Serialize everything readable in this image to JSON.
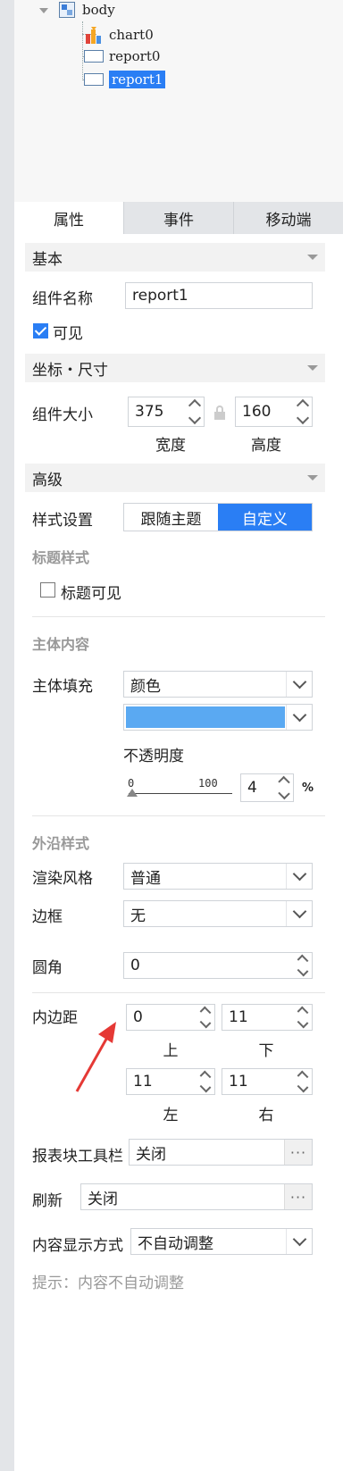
{
  "tree": {
    "root": "body",
    "children": [
      "chart0",
      "report0",
      "report1"
    ],
    "selected": "report1"
  },
  "tabs": [
    "属性",
    "事件",
    "移动端"
  ],
  "active_tab": "属性",
  "basic": {
    "header": "基本",
    "component_name_label": "组件名称",
    "component_name_value": "report1",
    "visible_label": "可见",
    "visible_checked": true
  },
  "coords": {
    "header": "坐标・尺寸",
    "size_label": "组件大小",
    "width_value": "375",
    "height_value": "160",
    "width_caption": "宽度",
    "height_caption": "高度"
  },
  "advanced": {
    "header": "高级",
    "style_label": "样式设置",
    "style_options": [
      "跟随主题",
      "自定义"
    ],
    "style_selected": "自定义",
    "title_style_heading": "标题样式",
    "title_visible_label": "标题可见",
    "title_visible_checked": false,
    "body_heading": "主体内容",
    "body_fill_label": "主体填充",
    "body_fill_value": "颜色",
    "fill_color": "#5aa9f2",
    "opacity_label": "不透明度",
    "slider_min": "0",
    "slider_max": "100",
    "opacity_value": "4",
    "percent_sign": "%",
    "outer_heading": "外沿样式",
    "render_label": "渲染风格",
    "render_value": "普通",
    "border_label": "边框",
    "border_value": "无",
    "radius_label": "圆角",
    "radius_value": "0",
    "padding_label": "内边距",
    "padding_top": "0",
    "padding_bottom": "11",
    "padding_left": "11",
    "padding_right": "11",
    "cap_top": "上",
    "cap_bottom": "下",
    "cap_left": "左",
    "cap_right": "右",
    "toolbar_label": "报表块工具栏",
    "toolbar_value": "关闭",
    "refresh_label": "刷新",
    "refresh_value": "关闭",
    "content_display_label": "内容显示方式",
    "content_display_value": "不自动调整",
    "hint": "提示：内容不自动调整",
    "ellipsis": "···"
  },
  "colors": {
    "accent": "#2a7ef4",
    "annotation_arrow": "#e53935"
  }
}
